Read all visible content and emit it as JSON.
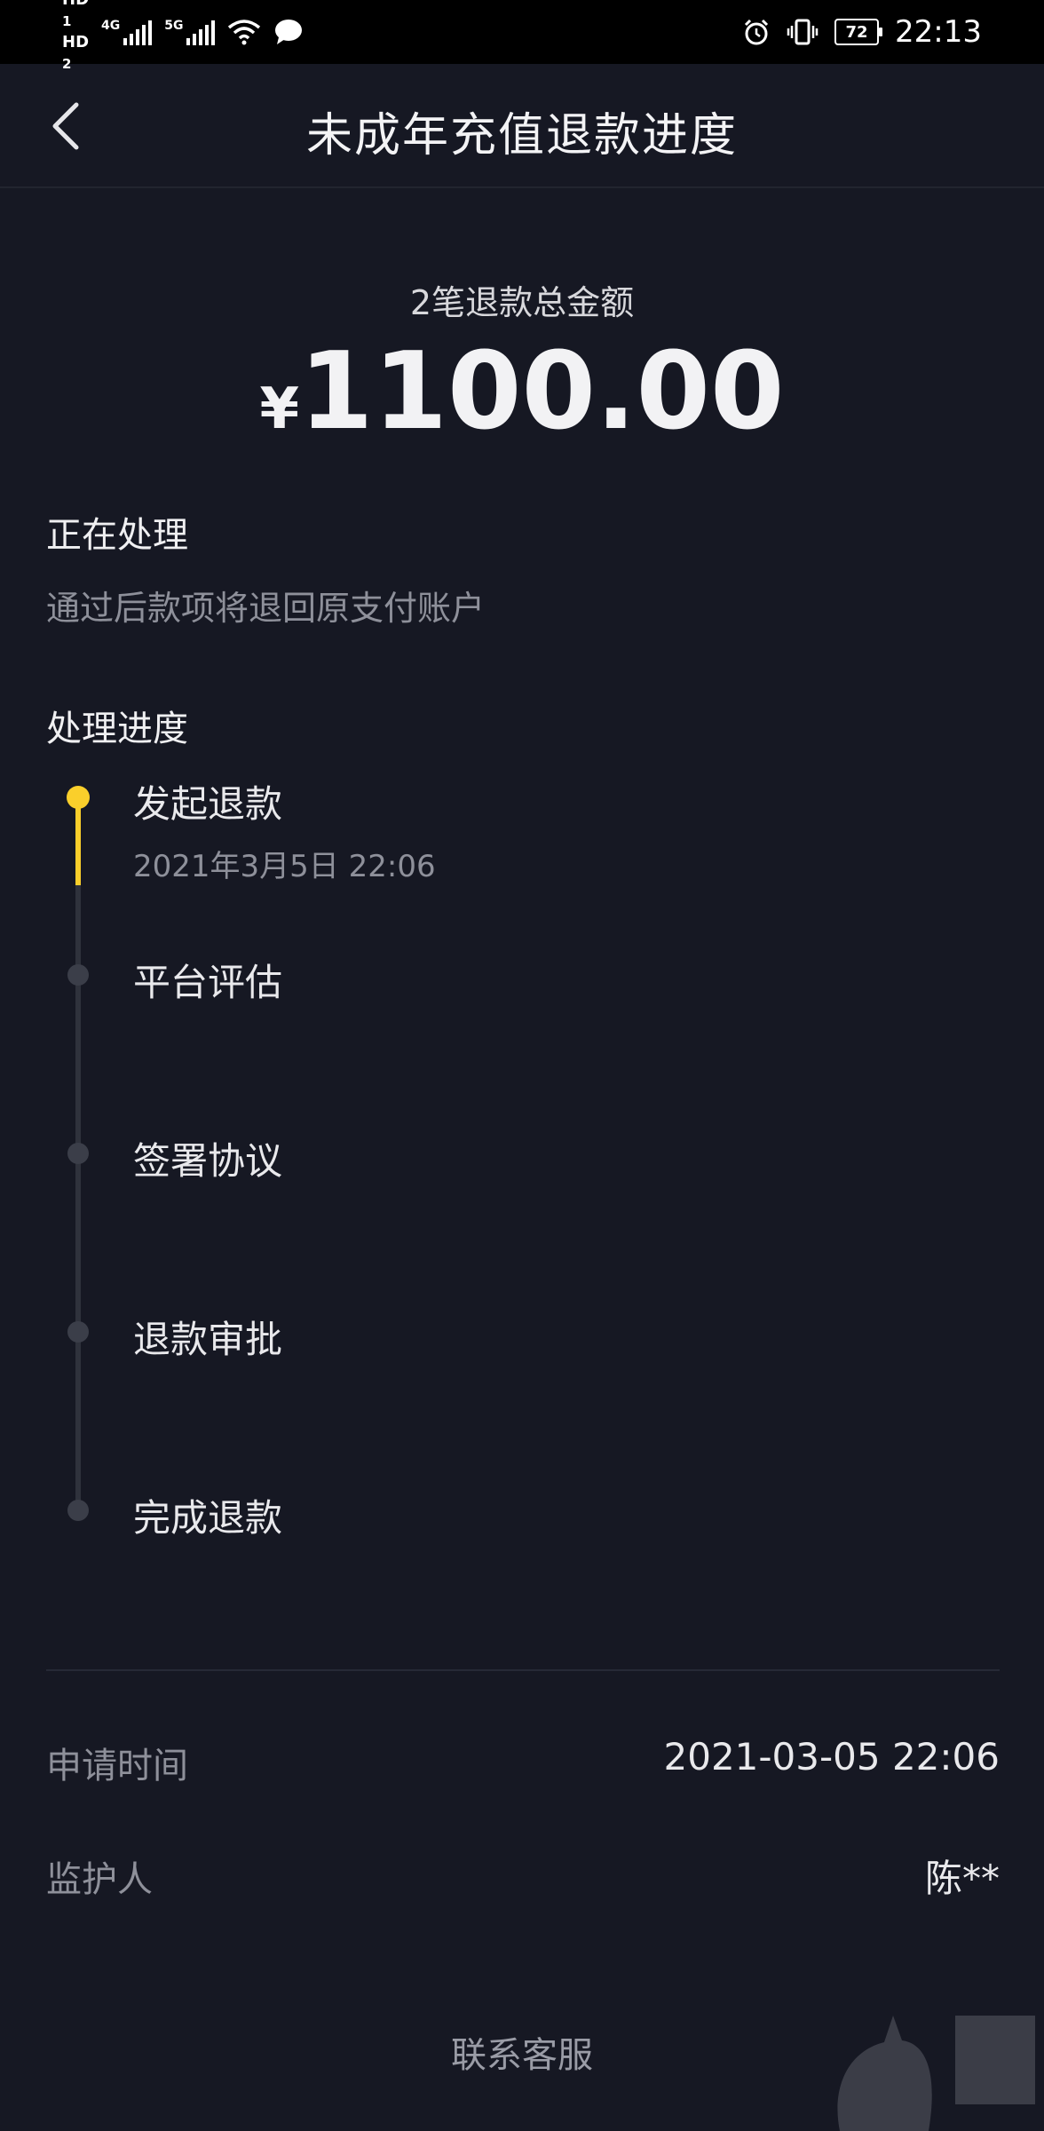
{
  "status_bar": {
    "hd1": "HD",
    "hd1_sub": "1",
    "hd2": "HD",
    "hd2_sub": "2",
    "net1": "4G",
    "net2": "5G",
    "battery": "72",
    "time": "22:13"
  },
  "navbar": {
    "title": "未成年充值退款进度"
  },
  "summary": {
    "total_label": "2笔退款总金额",
    "currency_symbol": "¥",
    "amount": "1100.00"
  },
  "status": {
    "title": "正在处理",
    "description": "通过后款项将退回原支付账户"
  },
  "progress": {
    "title": "处理进度",
    "steps": [
      {
        "label": "发起退款",
        "time": "2021年3月5日 22:06"
      },
      {
        "label": "平台评估"
      },
      {
        "label": "签署协议"
      },
      {
        "label": "退款审批"
      },
      {
        "label": "完成退款"
      }
    ],
    "completed_fraction": 0.2
  },
  "details": {
    "apply_time_label": "申请时间",
    "apply_time_value": "2021-03-05 22:06",
    "guardian_label": "监护人",
    "guardian_value": "陈**"
  },
  "footer": {
    "contact_label": "联系客服"
  },
  "colors": {
    "background": "#161823",
    "accent": "#facf2b",
    "muted_text": "#8e909a",
    "inactive_dot": "#3b3e49"
  }
}
